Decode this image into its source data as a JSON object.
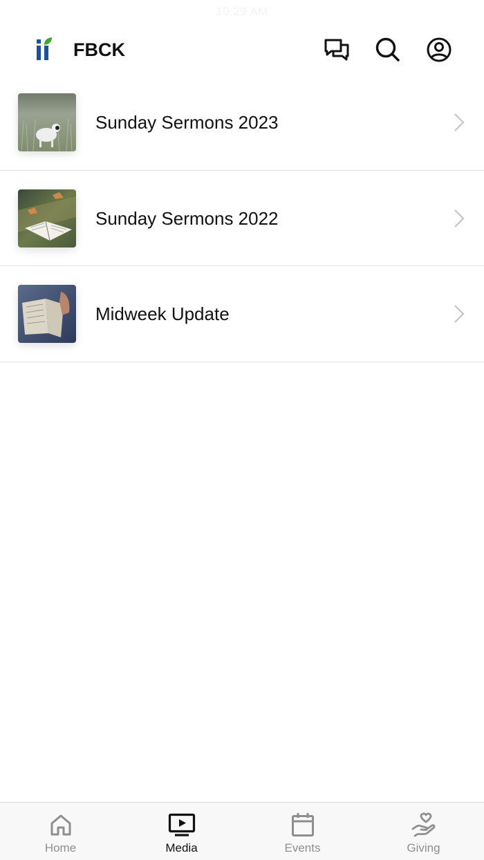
{
  "status_bar": {
    "time": "10:29 AM"
  },
  "header": {
    "title": "FBCK",
    "colors": {
      "logo_blue": "#1f4fa0",
      "logo_green": "#3fa535"
    }
  },
  "list": {
    "items": [
      {
        "label": "Sunday Sermons 2023",
        "thumbnail": "lamb-in-field"
      },
      {
        "label": "Sunday Sermons 2022",
        "thumbnail": "open-bible-on-table"
      },
      {
        "label": "Midweek Update",
        "thumbnail": "hand-on-bible"
      }
    ]
  },
  "tabbar": {
    "active": "Media",
    "tabs": [
      {
        "label": "Home",
        "icon": "home-icon"
      },
      {
        "label": "Media",
        "icon": "media-icon"
      },
      {
        "label": "Events",
        "icon": "calendar-icon"
      },
      {
        "label": "Giving",
        "icon": "giving-icon"
      }
    ]
  }
}
